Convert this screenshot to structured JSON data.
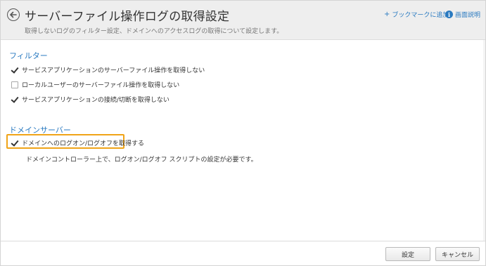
{
  "header": {
    "title": "サーバーファイル操作ログの取得設定",
    "subtitle": "取得しないログのフィルター設定、ドメインへのアクセスログの取得について設定します。",
    "bookmark_plus": "+",
    "bookmark_label": "ブックマークに追加",
    "help_icon": "i",
    "help_label": "画面説明"
  },
  "filter": {
    "title": "フィルター",
    "options": [
      {
        "label": "サービスアプリケーションのサーバーファイル操作を取得しない",
        "checked": true
      },
      {
        "label": "ローカルユーザーのサーバーファイル操作を取得しない",
        "checked": false
      },
      {
        "label": "サービスアプリケーションの接続/切断を取得しない",
        "checked": true
      }
    ]
  },
  "domain": {
    "title": "ドメインサーバー",
    "option": {
      "label": "ドメインへのログオン/ログオフを取得する",
      "checked": true
    },
    "note": "ドメインコントローラー上で、ログオン/ログオフ スクリプトの設定が必要です。"
  },
  "footer": {
    "save_label": "設定",
    "cancel_label": "キャンセル"
  },
  "colors": {
    "accent": "#2a7ac0",
    "highlight": "#f0a418",
    "header_bg": "#eeeeee"
  }
}
